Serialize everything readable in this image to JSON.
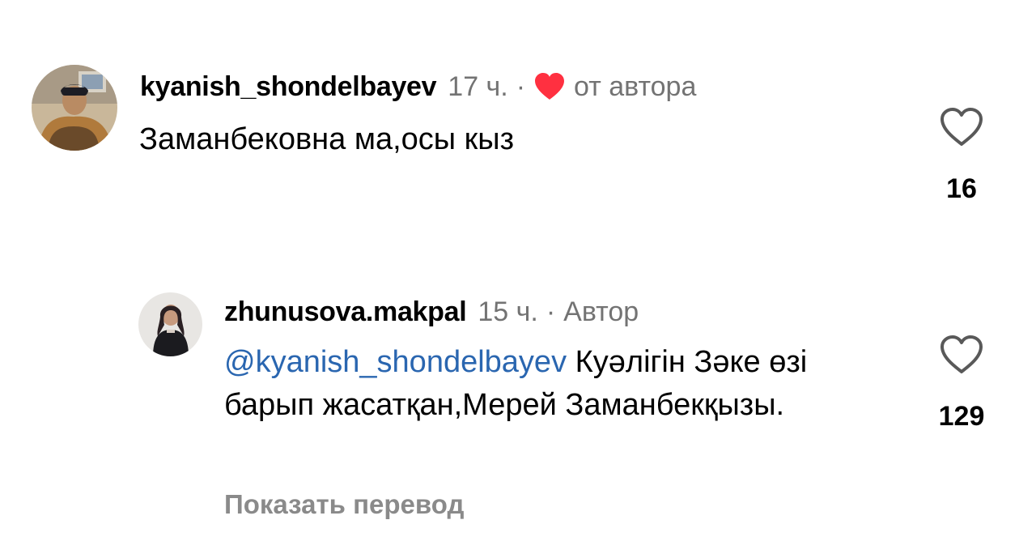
{
  "comments": [
    {
      "username": "kyanish_shondelbayev",
      "time": "17 ч.",
      "separator": "·",
      "author_liked_label": "от автора",
      "text": "Заманбековна ма,осы кыз",
      "likes": "16",
      "avatar_icon": "avatar-photo-man"
    }
  ],
  "replies": [
    {
      "username": "zhunusova.makpal",
      "time": "15 ч.",
      "separator": "·",
      "badge": "Автор",
      "mention": "@kyanish_shondelbayev",
      "text": " Куәлігін Зәке өзі барып жасатқан,Мерей Заманбекқызы.",
      "likes": "129",
      "avatar_icon": "avatar-photo-woman",
      "translate_label": "Показать перевод"
    }
  ],
  "colors": {
    "heart_red": "#ff3040",
    "mention_blue": "#2a66b0",
    "meta_gray": "#737373",
    "translate_gray": "#8a8a8a"
  },
  "icons": {
    "author_like": "heart-filled-icon",
    "like_button": "heart-outline-icon"
  }
}
